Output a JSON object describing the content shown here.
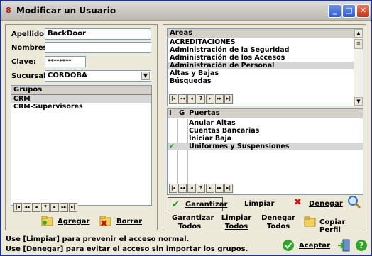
{
  "window": {
    "title": "Modificar un Usuario"
  },
  "form": {
    "apellido_label": "Apellido:",
    "apellido_value": "BackDoor",
    "nombres_label": "Nombres:",
    "nombres_value": "",
    "clave_label": "Clave:",
    "clave_value": "********",
    "sucursal_label": "Sucursal:",
    "sucursal_value": "CORDOBA"
  },
  "grupos": {
    "header": "Grupos",
    "items": [
      "CRM",
      "CRM-Supervisores"
    ]
  },
  "areas": {
    "header": "Areas",
    "items": [
      "ACREDITACIONES",
      "Administración de la Seguridad",
      "Administración de los Accesos",
      "Administración de Personal",
      "Altas y Bajas",
      "Búsquedas"
    ]
  },
  "puertas": {
    "col_i": "I",
    "col_g": "G",
    "col_name": "Puertas",
    "rows": [
      {
        "name": "Anular Altas",
        "checked": false
      },
      {
        "name": "Cuentas Bancarias",
        "checked": false
      },
      {
        "name": "Iniciar Baja",
        "checked": false
      },
      {
        "name": "Uniformes y Suspensiones",
        "checked": true
      }
    ]
  },
  "nav": {
    "first": "|◂",
    "prev_page": "◂◂",
    "prev": "◂",
    "help": "?",
    "next": "▸",
    "next_page": "▸▸",
    "last": "▸|"
  },
  "buttons": {
    "agregar": "Agregar",
    "borrar": "Borrar",
    "garantizar": "Garantizar",
    "limpiar": "Limpiar",
    "denegar": "Denegar",
    "garantizar_todos_1": "Garantizar",
    "garantizar_todos_2": "Todos",
    "limpiar_todos_1": "Limpiar",
    "limpiar_todos_2": "Todos",
    "denegar_todos_1": "Denegar",
    "denegar_todos_2": "Todos",
    "copiar_perfil": "Copiar Perfil",
    "aceptar": "Aceptar"
  },
  "footer": {
    "line1": "Use [Limpiar] para prevenir el acceso normal.",
    "line2": "Use [Denegar] para evitar el acceso sin importar los grupos."
  },
  "colors": {
    "selection": "#d6d6d6",
    "check": "#1a9b1a",
    "deny": "#cc1111",
    "title_bar_blue": "#2c5bd6"
  }
}
